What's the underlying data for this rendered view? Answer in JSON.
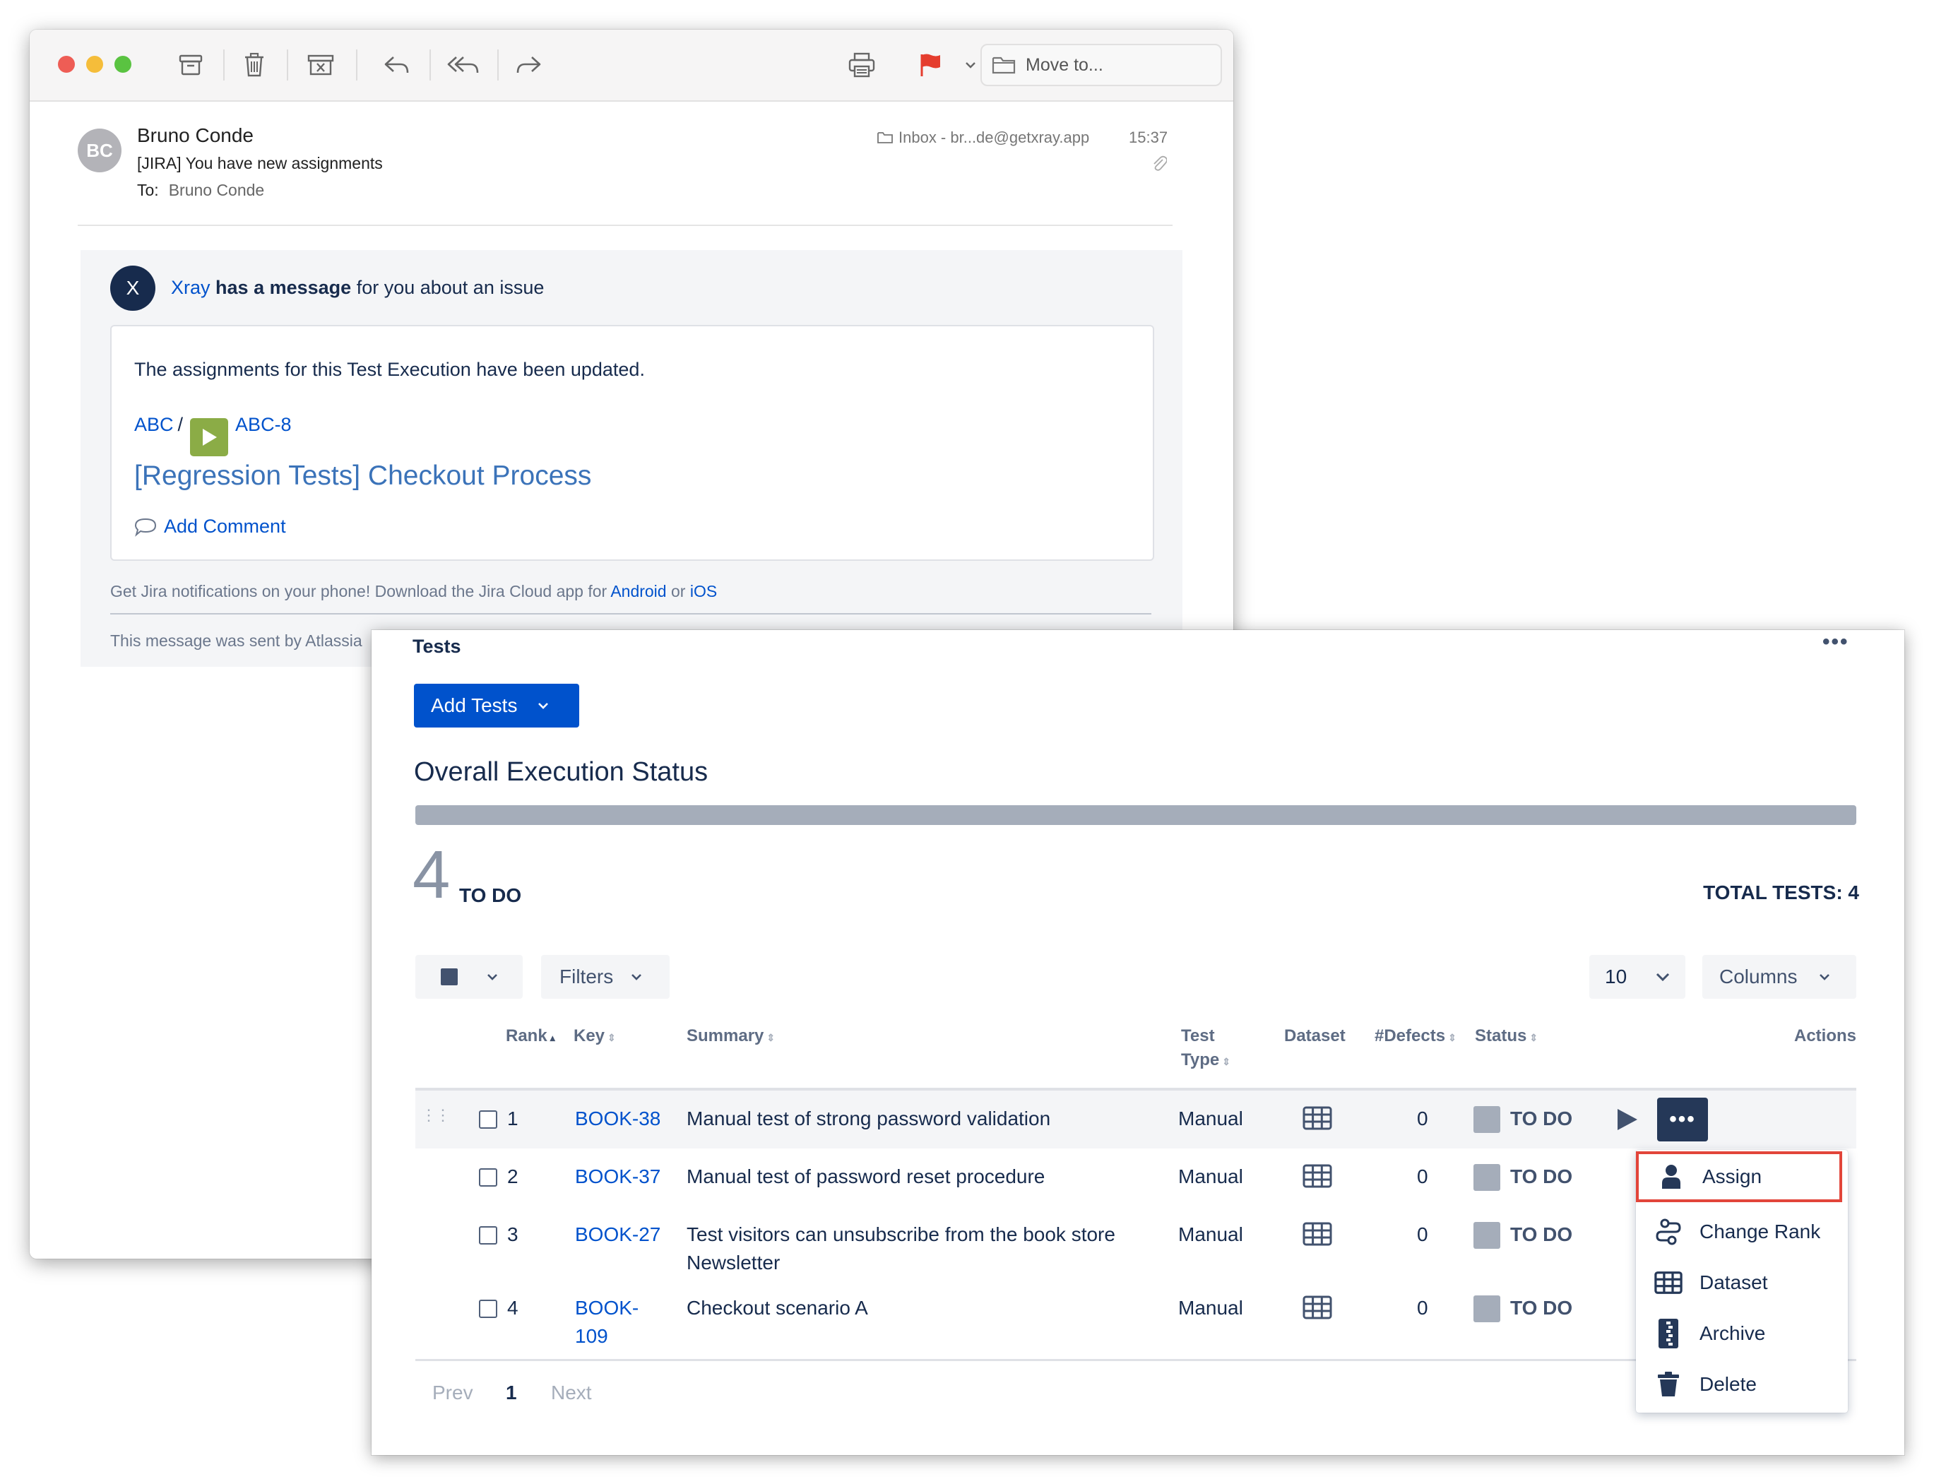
{
  "mail": {
    "toolbar": {
      "move_to_placeholder": "Move to...",
      "accent_flag_color": "#e53d2e"
    },
    "header": {
      "avatar_initials": "BC",
      "sender": "Bruno Conde",
      "subject": "[JIRA] You have new assignments",
      "to_label": "To:",
      "to_value": "Bruno Conde",
      "mailbox": "Inbox - br...de@getxray.app",
      "time": "15:37"
    },
    "message": {
      "avatar_initial": "X",
      "sender_link": "Xray",
      "has_a_message": "has a message",
      "about_text": "for you about an issue",
      "body_text": "The assignments for this Test Execution have been updated.",
      "project_link": "ABC",
      "crumb_sep": "/",
      "issue_key": "ABC-8",
      "issue_title": "[Regression Tests] Checkout Process",
      "add_comment": "Add Comment",
      "footer_prefix": "Get Jira notifications on your phone! Download the Jira Cloud app for",
      "footer_android": "Android",
      "footer_or": "or",
      "footer_ios": "iOS",
      "footer_sent": "This message was sent by Atlassia"
    }
  },
  "tests_panel": {
    "title": "Tests",
    "more": "•••",
    "add_tests_label": "Add Tests",
    "overall_title": "Overall Execution Status",
    "todo_count": "4",
    "todo_label": "TO DO",
    "todo_fraction": 1.0,
    "total_tests": "TOTAL TESTS: 4",
    "filters_label": "Filters",
    "page_size": "10",
    "columns_label": "Columns",
    "headers": {
      "rank": "Rank",
      "key": "Key",
      "summary": "Summary",
      "test_type_1": "Test",
      "test_type_2": "Type",
      "dataset": "Dataset",
      "defects": "#Defects",
      "status": "Status",
      "actions": "Actions"
    },
    "rows": [
      {
        "rank": "1",
        "key": "BOOK-38",
        "summary": "Manual test of strong password validation",
        "type": "Manual",
        "defects": "0",
        "status": "TO DO"
      },
      {
        "rank": "2",
        "key": "BOOK-37",
        "summary": "Manual test of password reset procedure",
        "type": "Manual",
        "defects": "0",
        "status": "TO DO"
      },
      {
        "rank": "3",
        "key": "BOOK-27",
        "summary": "Test visitors can unsubscribe from the book store",
        "summary2": "Newsletter",
        "type": "Manual",
        "defects": "0",
        "status": "TO DO"
      },
      {
        "rank": "4",
        "key": "BOOK-",
        "key2": "109",
        "summary": "Checkout scenario A",
        "type": "Manual",
        "defects": "0",
        "status": "TO DO"
      }
    ],
    "pager": {
      "prev": "Prev",
      "page": "1",
      "next": "Next"
    },
    "actions_menu": {
      "items": [
        "Assign",
        "Change Rank",
        "Dataset",
        "Archive",
        "Delete"
      ],
      "selected": "Assign",
      "highlight_color": "#e2453a"
    },
    "menu_peek": "s"
  }
}
